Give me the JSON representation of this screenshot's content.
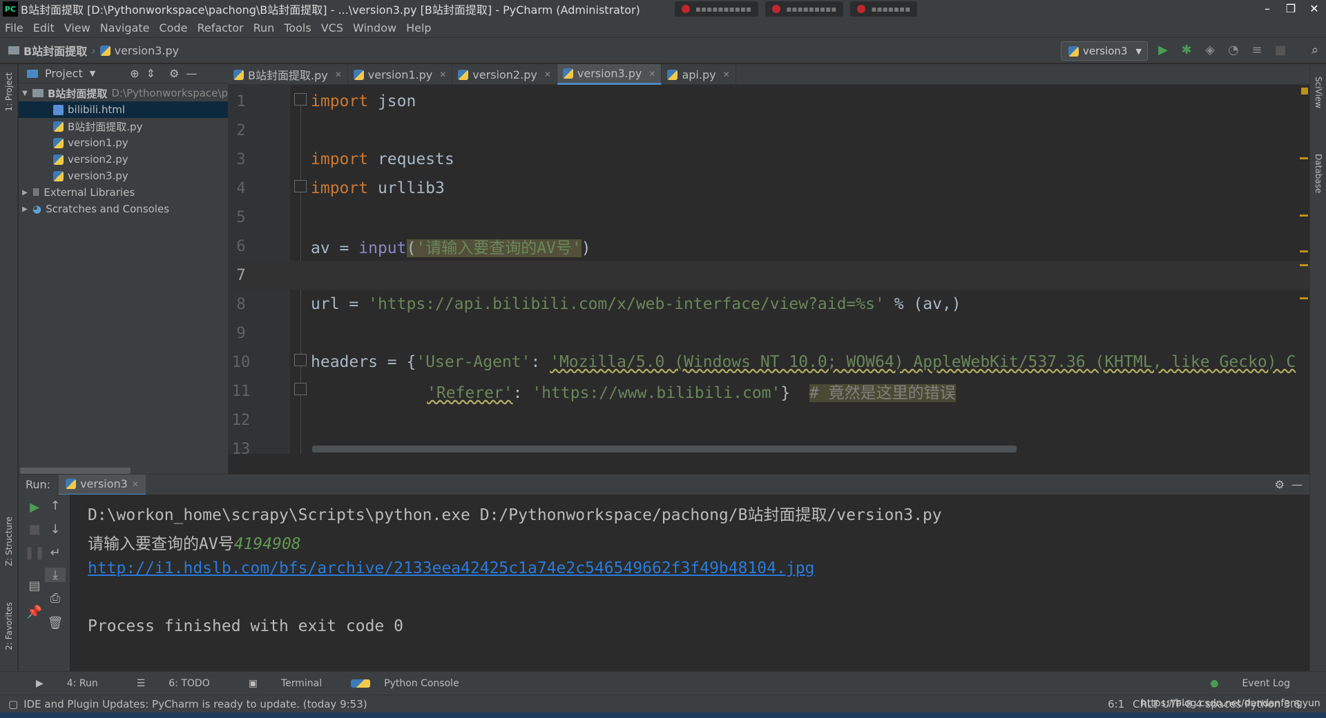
{
  "window": {
    "title": "B站封面提取 [D:\\Pythonworkspace\\pachong\\B站封面提取] - ...\\version3.py [B站封面提取] - PyCharm (Administrator)",
    "app_icon": "PC"
  },
  "menu": [
    "File",
    "Edit",
    "View",
    "Navigate",
    "Code",
    "Refactor",
    "Run",
    "Tools",
    "VCS",
    "Window",
    "Help"
  ],
  "breadcrumb": {
    "project": "B站封面提取",
    "file": "version3.py"
  },
  "run_config": "version3",
  "left_strip": {
    "project": "1: Project",
    "structure": "Z: Structure",
    "favorites": "2: Favorites"
  },
  "right_strip": {
    "sciview": "SciView",
    "database": "Database"
  },
  "project_panel": {
    "title": "Project",
    "root": {
      "name": "B站封面提取",
      "path": "D:\\Pythonworkspace\\p"
    },
    "files": [
      "bilibili.html",
      "B站封面提取.py",
      "version1.py",
      "version2.py",
      "version3.py"
    ],
    "external": "External Libraries",
    "scratches": "Scratches and Consoles"
  },
  "tabs": [
    "B站封面提取.py",
    "version1.py",
    "version2.py",
    "version3.py",
    "api.py"
  ],
  "active_tab": "version3.py",
  "code": {
    "l1_kw": "import",
    "l1_rest": " json",
    "l3_kw": "import",
    "l3_rest": " requests",
    "l4_kw": "import",
    "l4_rest": " urllib3",
    "l6_a": "av = ",
    "l6_fn": "input",
    "l6_p": "(",
    "l6_str": "'请输入要查询的AV号'",
    "l6_e": ")",
    "l8_a": "url = ",
    "l8_str": "'https://api.bilibili.com/x/web-interface/view?aid=%s'",
    "l8_b": " % (av,)",
    "l10_a": "headers = {",
    "l10_k": "'User-Agent'",
    "l10_c": ": ",
    "l10_v": "'Mozilla/5.0 (Windows NT 10.0; WOW64) AppleWebKit/537.36 (KHTML, like Gecko) C",
    "l11_k": "'Referer'",
    "l11_c": ": ",
    "l11_v": "'https://www.bilibili.com'",
    "l11_e": "}  ",
    "l11_cm": "# 竟然是这里的错误"
  },
  "line_numbers": [
    "1",
    "2",
    "3",
    "4",
    "5",
    "6",
    "7",
    "8",
    "9",
    "10",
    "11",
    "12",
    "13"
  ],
  "run": {
    "label": "Run:",
    "tab": "version3",
    "cmd": "D:\\workon_home\\scrapy\\Scripts\\python.exe D:/Pythonworkspace/pachong/B站封面提取/version3.py",
    "prompt": "请输入要查询的AV号",
    "input": "4194908",
    "url": "http://i1.hdslb.com/bfs/archive/2133eea42425c1a74e2c546549662f3f49b48104.jpg",
    "exit": "Process finished with exit code 0"
  },
  "bottom_tools": {
    "run": "4: Run",
    "todo": "6: TODO",
    "terminal": "Terminal",
    "console": "Python Console",
    "event_log": "Event Log"
  },
  "status": {
    "message": "IDE and Plugin Updates: PyCharm is ready to update. (today 9:53)",
    "position": "6:1",
    "encoding": "CRLF   UTF-8   4 spaces   Python 3.6",
    "watermark": "https://blog.csdn.net/dandanfengyun"
  },
  "colors": {
    "accent": "#4a88c7",
    "keyword": "#cc7832",
    "string": "#6a8759",
    "link": "#287bde"
  }
}
